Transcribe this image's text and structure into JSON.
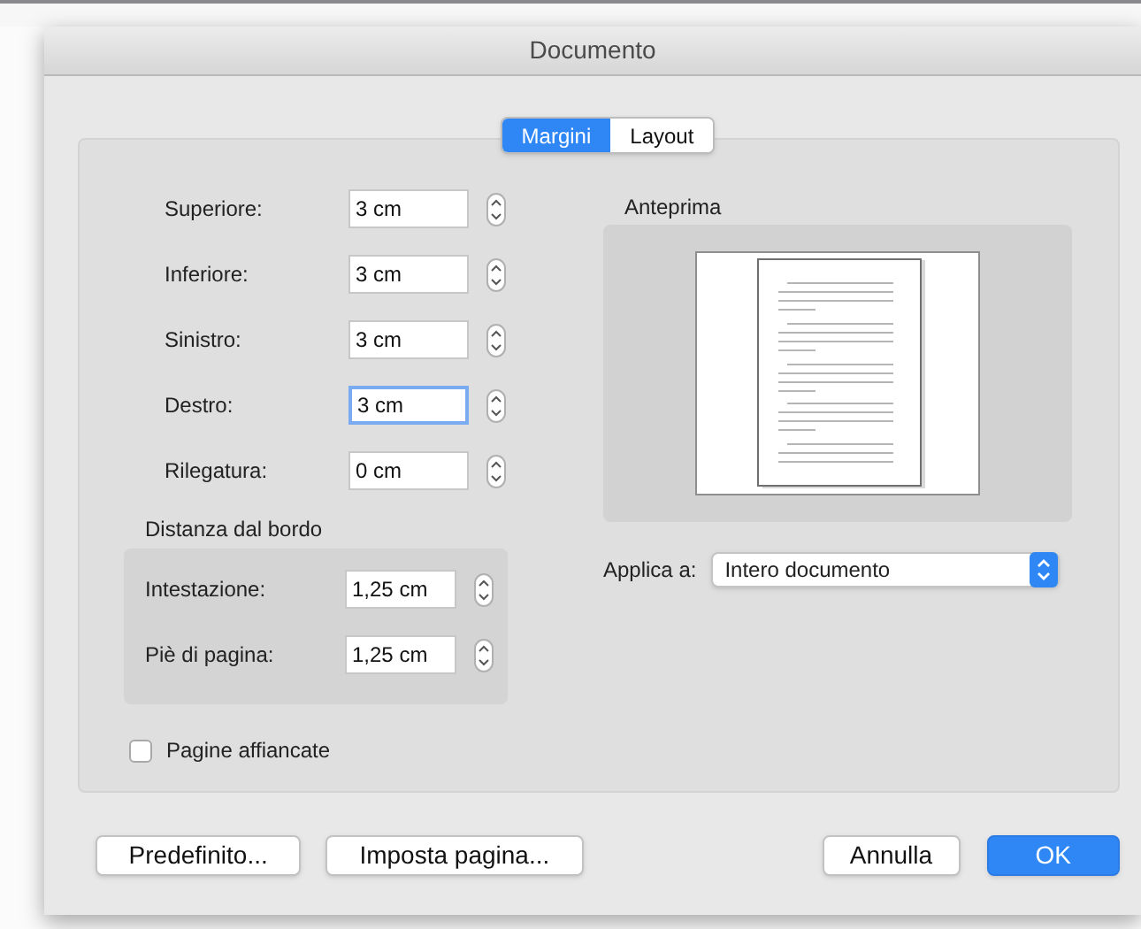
{
  "window": {
    "title": "Documento"
  },
  "tabs": [
    {
      "label": "Margini",
      "selected": true
    },
    {
      "label": "Layout",
      "selected": false
    }
  ],
  "margins": [
    {
      "label": "Superiore:",
      "value": "3 cm",
      "focused": false
    },
    {
      "label": "Inferiore:",
      "value": "3 cm",
      "focused": false
    },
    {
      "label": "Sinistro:",
      "value": "3 cm",
      "focused": false
    },
    {
      "label": "Destro:",
      "value": "3 cm",
      "focused": true
    },
    {
      "label": "Rilegatura:",
      "value": "0 cm",
      "focused": false
    }
  ],
  "edge_distance": {
    "title": "Distanza dal bordo",
    "fields": [
      {
        "label": "Intestazione:",
        "value": "1,25 cm"
      },
      {
        "label": "Piè di pagina:",
        "value": "1,25 cm"
      }
    ]
  },
  "facing_pages": {
    "label": "Pagine affiancate",
    "checked": false
  },
  "preview": {
    "title": "Anteprima"
  },
  "apply_to": {
    "label": "Applica a:",
    "value": "Intero documento"
  },
  "buttons": [
    {
      "label": "Predefinito...",
      "primary": false
    },
    {
      "label": "Imposta pagina...",
      "primary": false
    },
    {
      "label": "Annulla",
      "primary": false
    },
    {
      "label": "OK",
      "primary": true
    }
  ]
}
